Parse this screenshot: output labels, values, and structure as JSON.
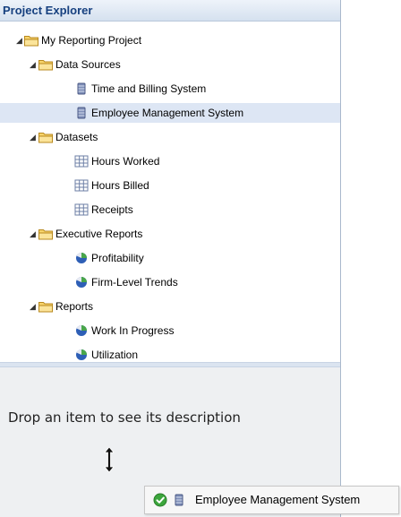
{
  "panel": {
    "title": "Project Explorer"
  },
  "tree": {
    "project": "My Reporting Project",
    "data_sources": {
      "label": "Data Sources",
      "items": [
        "Time and Billing System",
        "Employee Management System"
      ]
    },
    "datasets": {
      "label": "Datasets",
      "items": [
        "Hours Worked",
        "Hours Billed",
        "Receipts"
      ]
    },
    "executive_reports": {
      "label": "Executive Reports",
      "items": [
        "Profitability",
        "Firm-Level Trends"
      ]
    },
    "reports": {
      "label": "Reports",
      "items": [
        "Work In Progress",
        "Utilization"
      ]
    }
  },
  "selected_item": "Employee Management System",
  "drop_zone": {
    "text": "Drop an item to see its description"
  },
  "drag_item": {
    "label": "Employee Management System",
    "status_icon": "green-check-icon",
    "type_icon": "database-icon"
  },
  "colors": {
    "header_text": "#16407f",
    "selection": "#dde6f4",
    "folder": "#f2c94c",
    "check": "#3ca63c"
  }
}
